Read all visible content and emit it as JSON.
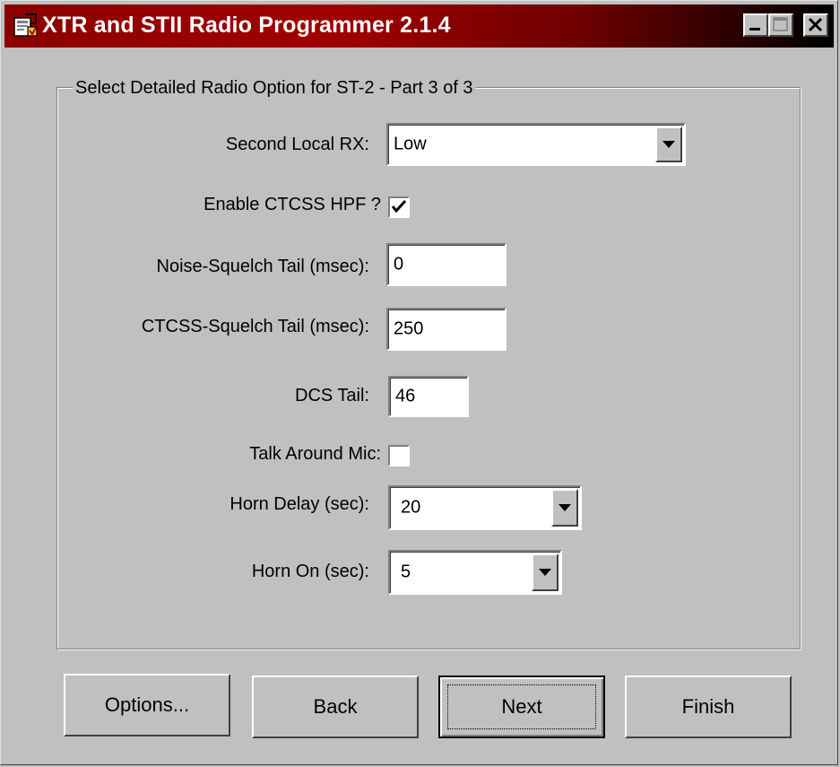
{
  "window": {
    "title": "XTR and STII Radio Programmer 2.1.4"
  },
  "titlebar_buttons": {
    "minimize": "minimize-icon",
    "maximize": "maximize-icon",
    "close": "close-icon"
  },
  "group": {
    "label": "Select Detailed Radio Option for ST-2 - Part 3 of 3"
  },
  "fields": {
    "second_local_rx": {
      "label": "Second Local RX:",
      "value": "Low"
    },
    "enable_ctcss_hpf": {
      "label": "Enable CTCSS HPF ?",
      "checked": true
    },
    "noise_squelch_tail": {
      "label": "Noise-Squelch Tail (msec):",
      "value": "0"
    },
    "ctcss_squelch_tail": {
      "label": "CTCSS-Squelch Tail (msec):",
      "value": "250"
    },
    "dcs_tail": {
      "label": "DCS Tail:",
      "value": "46"
    },
    "talk_around_mic": {
      "label": "Talk Around Mic:",
      "checked": false
    },
    "horn_delay": {
      "label": "Horn Delay (sec):",
      "value": "20"
    },
    "horn_on": {
      "label": "Horn On (sec):",
      "value": "5"
    }
  },
  "buttons": {
    "options": "Options...",
    "back": "Back",
    "next": "Next",
    "finish": "Finish"
  },
  "colors": {
    "titlebar_start": "#8b0000",
    "titlebar_end": "#000000",
    "face": "#c0c0c0"
  }
}
